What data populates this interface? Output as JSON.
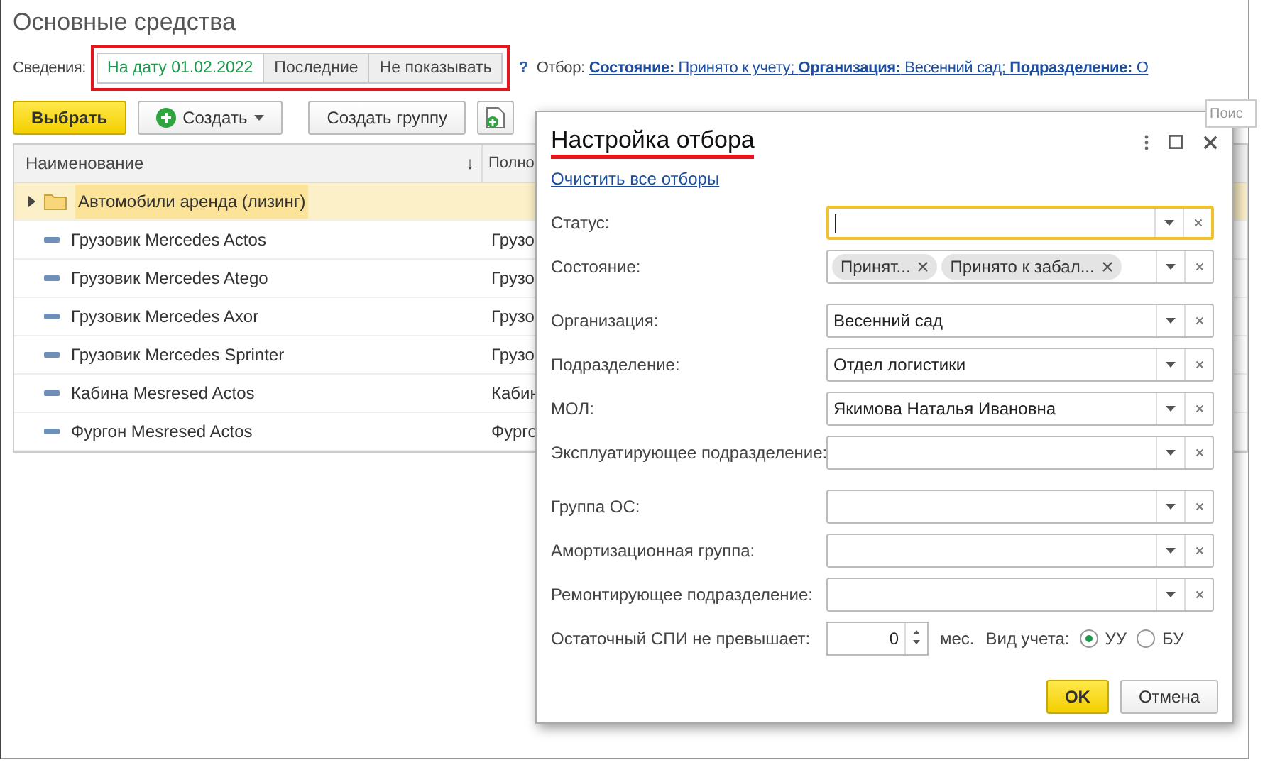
{
  "window": {
    "title": "Основные средства"
  },
  "info": {
    "label": "Сведения:",
    "options": [
      {
        "label": "На дату 01.02.2022",
        "selected": true
      },
      {
        "label": "Последние",
        "selected": false
      },
      {
        "label": "Не показывать",
        "selected": false
      }
    ],
    "help": "?",
    "filter_label": "Отбор:",
    "filter_link": "**Состояние:** Принято к учету; **Организация:** Весенний сад; **Подразделение:** О"
  },
  "toolbar": {
    "select": "Выбрать",
    "create": "Создать",
    "create_group": "Создать группу",
    "search": {
      "placeholder": "Поис"
    }
  },
  "table": {
    "columns": [
      {
        "label": "Наименование",
        "sort": "↓"
      },
      {
        "label": "Полно"
      }
    ],
    "rows": [
      {
        "kind": "group",
        "name": "Автомобили аренда (лизинг)",
        "selected": true
      },
      {
        "kind": "item",
        "name": "Грузовик Mercedes Actos",
        "full": "Грузо",
        "selected": false
      },
      {
        "kind": "item",
        "name": "Грузовик Mercedes Atego",
        "full": "Грузо",
        "selected": false
      },
      {
        "kind": "item",
        "name": "Грузовик Mercedes Axor",
        "full": "Грузо",
        "selected": false
      },
      {
        "kind": "item",
        "name": "Грузовик Mercedes Sprinter",
        "full": "Грузо",
        "selected": false
      },
      {
        "kind": "item",
        "name": "Кабина Mesresed Actos",
        "full": "Кабин",
        "selected": false
      },
      {
        "kind": "item",
        "name": "Фургон Mesresed Actos",
        "full": "Фурго",
        "selected": false
      }
    ]
  },
  "dialog": {
    "title": "Настройка отбора",
    "clear_link": "Очистить все отборы",
    "field_groups": [
      {
        "fields": [
          {
            "label": "Статус:",
            "kind": "select",
            "focused": true
          },
          {
            "label": "Состояние:",
            "kind": "tags",
            "tags": [
              "Принят...",
              "Принято к забал..."
            ],
            "focused": false
          }
        ]
      },
      {
        "fields": [
          {
            "label": "Организация:",
            "kind": "select",
            "value": "Весенний сад",
            "focused": false
          },
          {
            "label": "Подразделение:",
            "kind": "select",
            "value": "Отдел логистики",
            "focused": false
          },
          {
            "label": "МОЛ:",
            "kind": "select",
            "value": "Якимова Наталья Ивановна",
            "focused": false
          },
          {
            "label": "Эксплуатирующее подразделение:",
            "kind": "select",
            "focused": false
          }
        ]
      },
      {
        "fields": [
          {
            "label": "Группа ОС:",
            "kind": "select",
            "focused": false
          },
          {
            "label": "Амортизационная группа:",
            "kind": "select",
            "focused": false
          },
          {
            "label": "Ремонтирующее подразделение:",
            "kind": "select",
            "focused": false
          }
        ]
      }
    ],
    "remaining": {
      "label": "Остаточный СПИ не превышает:",
      "value": "0",
      "unit": "мес.",
      "accounting_label": "Вид учета:",
      "options": [
        {
          "label": "УУ",
          "selected": true
        },
        {
          "label": "БУ",
          "selected": false
        }
      ]
    },
    "ok": "OK",
    "cancel": "Отмена"
  }
}
